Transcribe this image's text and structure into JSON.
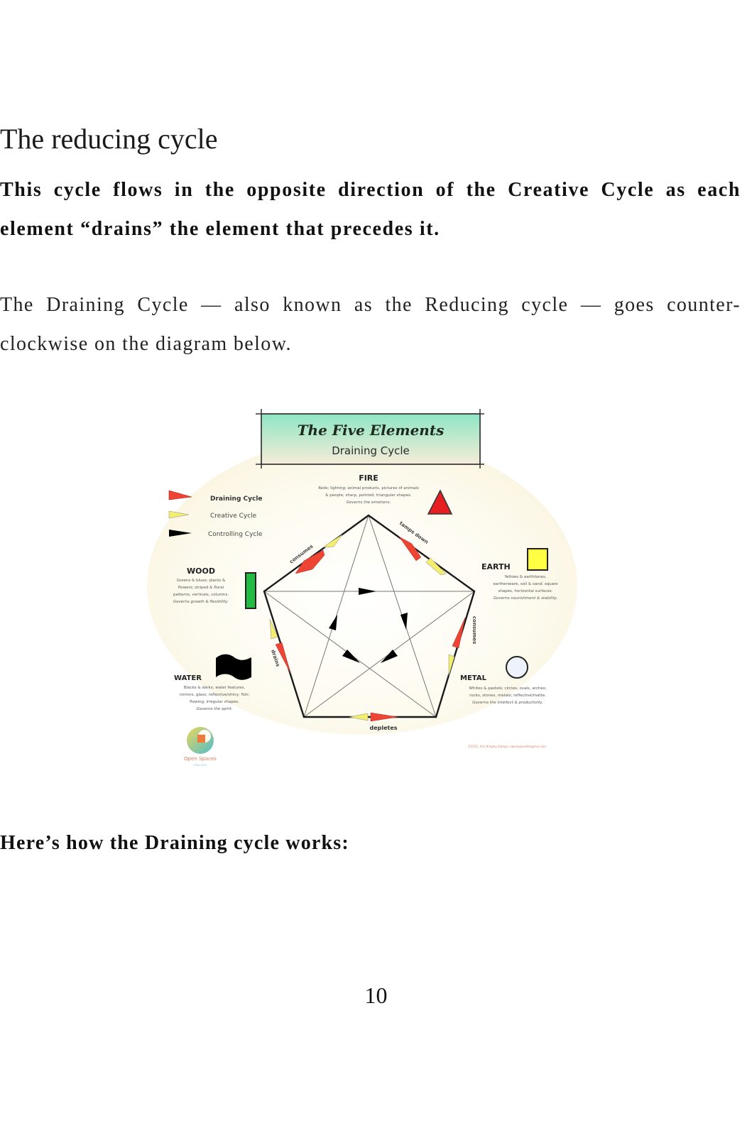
{
  "page": {
    "heading": "The reducing cycle",
    "intro_bold": "This cycle flows in the opposite direction of the Creative Cycle as each element “drains” the element that precedes it.",
    "intro_body": "The Draining Cycle — also known as the Reducing cycle — goes counter-clockwise on the diagram below.",
    "how_heading": "Here’s how the Draining cycle works:",
    "page_number": "10"
  },
  "diagram": {
    "title": "The Five Elements",
    "subtitle": "Draining Cycle",
    "legend": [
      {
        "label": "Draining Cycle",
        "color": "#ee4433",
        "icon": "red-arrow-icon"
      },
      {
        "label": "Creative Cycle",
        "color": "#f4ee70",
        "icon": "yellow-arrow-icon"
      },
      {
        "label": "Controlling Cycle",
        "color": "#000000",
        "icon": "black-arrow-icon"
      }
    ],
    "elements": {
      "fire": {
        "name": "FIRE",
        "lines": [
          "Reds; lighting; animal products, pictures of animals",
          "& people; sharp, pointed, triangular shapes.",
          "Governs the emotions."
        ],
        "shape": "triangle",
        "color": "#e62020"
      },
      "earth": {
        "name": "EARTH",
        "lines": [
          "Yellows & earthtones,",
          "earthenware, soil & sand; square",
          "shapes, horizontal surfaces.",
          "Governs nourishment & stability."
        ],
        "shape": "square",
        "color": "#ffff44"
      },
      "metal": {
        "name": "METAL",
        "lines": [
          "Whites & pastels; circles, ovals, arches;",
          "rocks, stones, metals; reflective/matte.",
          "Governs the intellect & productivity."
        ],
        "shape": "circle",
        "color": "#eef3fb"
      },
      "water": {
        "name": "WATER",
        "lines": [
          "Blacks & darks; water features,",
          "mirrors, glass; reflective/shiny; fish;",
          "flowing, irregular shapes.",
          "Governs the spirit."
        ],
        "shape": "wave",
        "color": "#000000"
      },
      "wood": {
        "name": "WOOD",
        "lines": [
          "Greens & blues; plants &",
          "flowers; striped & floral",
          "patterns, verticals, columns.",
          "Governs growth & flexibility."
        ],
        "shape": "rectangle",
        "color": "#22bb44"
      }
    },
    "edge_labels": {
      "wood_fire": "consumes",
      "fire_earth": "tamps down",
      "earth_metal": "consumes",
      "metal_water": "depletes",
      "water_wood": "drains"
    },
    "logo_text": "Open Spaces",
    "logo_subtext": "FENG SHUI",
    "credit": "©2012, Ann Bingley Gallops, openspacesfengshui.com"
  }
}
